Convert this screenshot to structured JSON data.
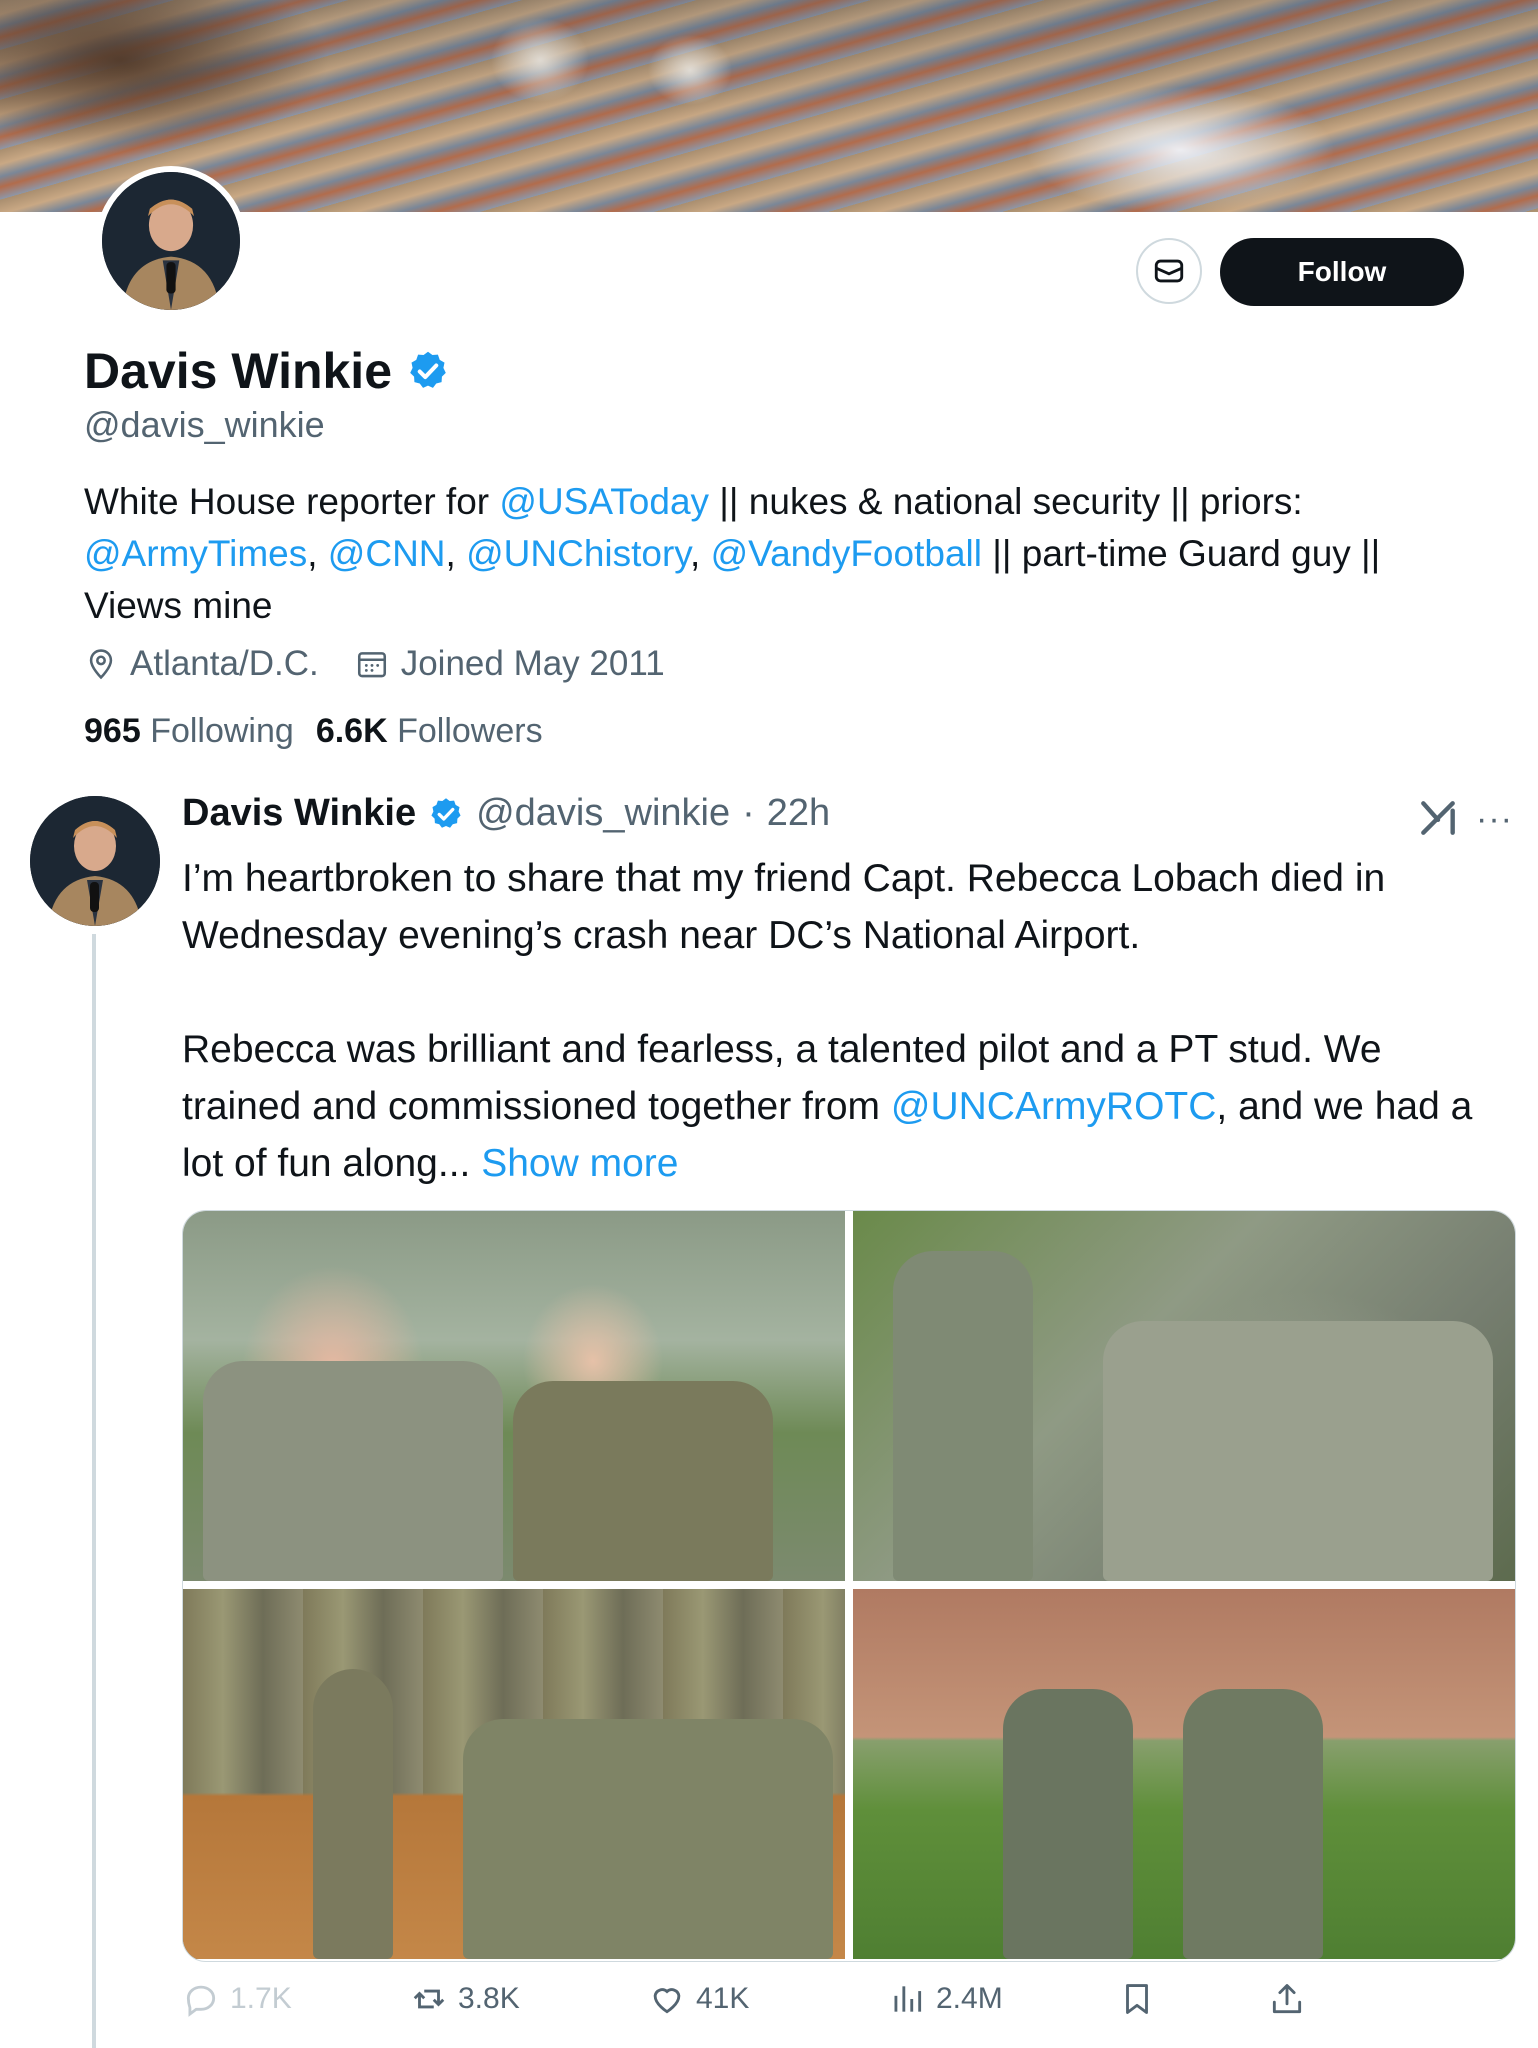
{
  "profile": {
    "name": "Davis Winkie",
    "handle": "@davis_winkie",
    "follow_label": "Follow",
    "bio": {
      "t1": "White House reporter for ",
      "m1": "@USAToday",
      "t2": " || nukes & national security || priors: ",
      "m2": "@ArmyTimes",
      "t3": ", ",
      "m3": "@CNN",
      "t4": ", ",
      "m4": "@UNChistory",
      "t5": ", ",
      "m5": "@VandyFootball",
      "t6": " || part-time Guard guy || Views mine"
    },
    "location": "Atlanta/D.C.",
    "joined": "Joined May 2011",
    "following_count": "965",
    "following_label": "Following",
    "followers_count": "6.6K",
    "followers_label": "Followers"
  },
  "tweet": {
    "name": "Davis Winkie",
    "handle": "@davis_winkie",
    "separator": "·",
    "time": "22h",
    "more": "···",
    "p1": "I’m heartbroken to share that my friend Capt. Rebecca Lobach died in Wednesday evening’s crash near DC’s National Airport.",
    "p2_a": "Rebecca was brilliant and fearless, a talented pilot and a PT stud. We trained and commissioned together from ",
    "p2_mention": "@UNCArmyROTC",
    "p2_b": ", and we had a lot of fun along... ",
    "show_more": "Show more",
    "actions": {
      "replies": "1.7K",
      "reposts": "3.8K",
      "likes": "41K",
      "views": "2.4M"
    }
  },
  "icons": {
    "verified": "verified-badge-icon",
    "message": "envelope-icon",
    "location": "location-pin-icon",
    "calendar": "calendar-icon",
    "grok": "grok-icon",
    "reply": "reply-icon",
    "repost": "repost-icon",
    "like": "heart-icon",
    "views": "views-icon",
    "bookmark": "bookmark-icon",
    "share": "share-icon"
  },
  "colors": {
    "accent": "#1d9bf0",
    "text": "#0f1419",
    "muted": "#536471",
    "button": "#0f1419"
  }
}
